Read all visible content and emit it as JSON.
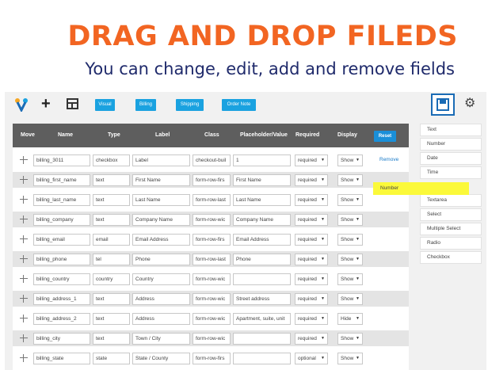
{
  "banner": {
    "headline": "DRAG AND DROP FILEDS",
    "subline": "You can change, edit, add and remove fields"
  },
  "toolbar": {
    "tabs": [
      "Visual",
      "Billing",
      "Shipping",
      "Order Note"
    ]
  },
  "table": {
    "headers": {
      "move": "Move",
      "name": "Name",
      "type": "Type",
      "label": "Label",
      "class": "Class",
      "placeholder": "Placeholder/Value",
      "required": "Required",
      "display": "Display"
    },
    "reset_label": "Reset",
    "remove_label": "Remove",
    "rows": [
      {
        "name": "billing_3011",
        "type": "checkbox",
        "label": "Label",
        "class": "checkout-buil",
        "placeholder": "1",
        "required": "required",
        "display": "Show"
      },
      {
        "name": "billing_first_name",
        "type": "text",
        "label": "First Name",
        "class": "form-row-firs",
        "placeholder": "First Name",
        "required": "required",
        "display": "Show"
      },
      {
        "name": "billing_last_name",
        "type": "text",
        "label": "Last Name",
        "class": "form-row-last",
        "placeholder": "Last Name",
        "required": "required",
        "display": "Show"
      },
      {
        "name": "billing_company",
        "type": "text",
        "label": "Company Name",
        "class": "form-row-wic",
        "placeholder": "Company Name",
        "required": "required",
        "display": "Show"
      },
      {
        "name": "billing_email",
        "type": "email",
        "label": "Email Address",
        "class": "form-row-firs",
        "placeholder": "Email Address",
        "required": "required",
        "display": "Show"
      },
      {
        "name": "billing_phone",
        "type": "tel",
        "label": "Phone",
        "class": "form-row-last",
        "placeholder": "Phone",
        "required": "required",
        "display": "Show"
      },
      {
        "name": "billing_country",
        "type": "country",
        "label": "Country",
        "class": "form-row-wic",
        "placeholder": "",
        "required": "required",
        "display": "Show"
      },
      {
        "name": "billing_address_1",
        "type": "text",
        "label": "Address",
        "class": "form-row-wic",
        "placeholder": "Street address",
        "required": "required",
        "display": "Show"
      },
      {
        "name": "billing_address_2",
        "type": "text",
        "label": "Address",
        "class": "form-row-wic",
        "placeholder": "Apartment, suite, unit",
        "required": "required",
        "display": "Hide"
      },
      {
        "name": "billing_city",
        "type": "text",
        "label": "Town / City",
        "class": "form-row-wic",
        "placeholder": "",
        "required": "required",
        "display": "Show"
      },
      {
        "name": "billing_state",
        "type": "state",
        "label": "State / County",
        "class": "form-row-firs",
        "placeholder": "",
        "required": "optional",
        "display": "Show"
      }
    ]
  },
  "palette": {
    "items": [
      "Text",
      "Number",
      "Date",
      "Time",
      "Textarea",
      "Select",
      "Multiple Select",
      "Radio",
      "Checkbox"
    ],
    "dragging": "Number"
  },
  "colors": {
    "headline": "#f26522",
    "subline": "#1f2a6b",
    "accent": "#1aa2e0",
    "drag_highlight": "#fbf93a"
  }
}
